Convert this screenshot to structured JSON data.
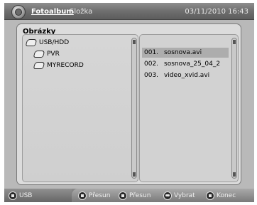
{
  "header": {
    "title": "Fotoalbum",
    "section": "Složka",
    "datetime": "03/11/2010 16:43"
  },
  "panel": {
    "title": "Obrázky"
  },
  "tree": {
    "items": [
      {
        "label": "USB/HDD",
        "icon": "folder-icon"
      },
      {
        "label": "PVR",
        "icon": "folder-icon"
      },
      {
        "label": "MYRECORD",
        "icon": "folder-icon"
      }
    ]
  },
  "files": {
    "rows": [
      {
        "num": "001.",
        "name": "sosnova.avi",
        "selected": true
      },
      {
        "num": "002.",
        "name": "sosnova_25_04_2",
        "selected": false
      },
      {
        "num": "003.",
        "name": "video_xvid.avi",
        "selected": false
      }
    ]
  },
  "footer": {
    "usb": "USB",
    "move1": "Přesun",
    "move2": "Přesun",
    "select": "Vybrat",
    "exit": "Konec"
  }
}
